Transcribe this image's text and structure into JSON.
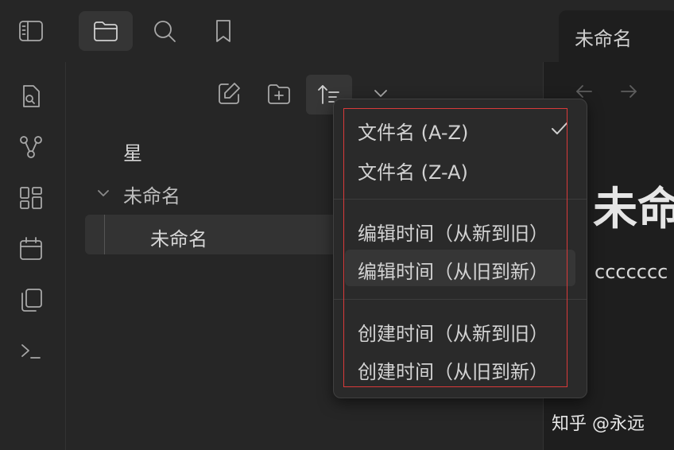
{
  "tab": {
    "title": "未命名"
  },
  "top_icons": [
    "sidebar-toggle-icon",
    "folder-icon",
    "search-icon",
    "bookmark-icon"
  ],
  "ribbon_icons": [
    "quick-switcher-icon",
    "graph-view-icon",
    "canvas-icon",
    "daily-note-icon",
    "templates-icon",
    "terminal-icon"
  ],
  "explorer": {
    "nav_icons": [
      "new-note-icon",
      "new-folder-icon",
      "sort-icon",
      "collapse-chevron-icon"
    ],
    "tree": {
      "file_star": "星",
      "folder": "未命名",
      "child": "未命名"
    }
  },
  "sort_menu": {
    "groups": [
      {
        "items": [
          {
            "label": "文件名 (A-Z)",
            "checked": true
          },
          {
            "label": "文件名 (Z-A)",
            "checked": false
          }
        ]
      },
      {
        "items": [
          {
            "label": "编辑时间（从新到旧）",
            "checked": false
          },
          {
            "label": "编辑时间（从旧到新）",
            "checked": false
          }
        ]
      },
      {
        "items": [
          {
            "label": "创建时间（从新到旧）",
            "checked": false
          },
          {
            "label": "创建时间（从旧到新）",
            "checked": false
          }
        ]
      }
    ]
  },
  "editor": {
    "heading": "未命",
    "body": "ccccccc"
  },
  "watermark": "知乎 @永远",
  "colors": {
    "highlight_border": "#d93a3a",
    "background": "#1e1e1e",
    "panel": "#262626"
  }
}
